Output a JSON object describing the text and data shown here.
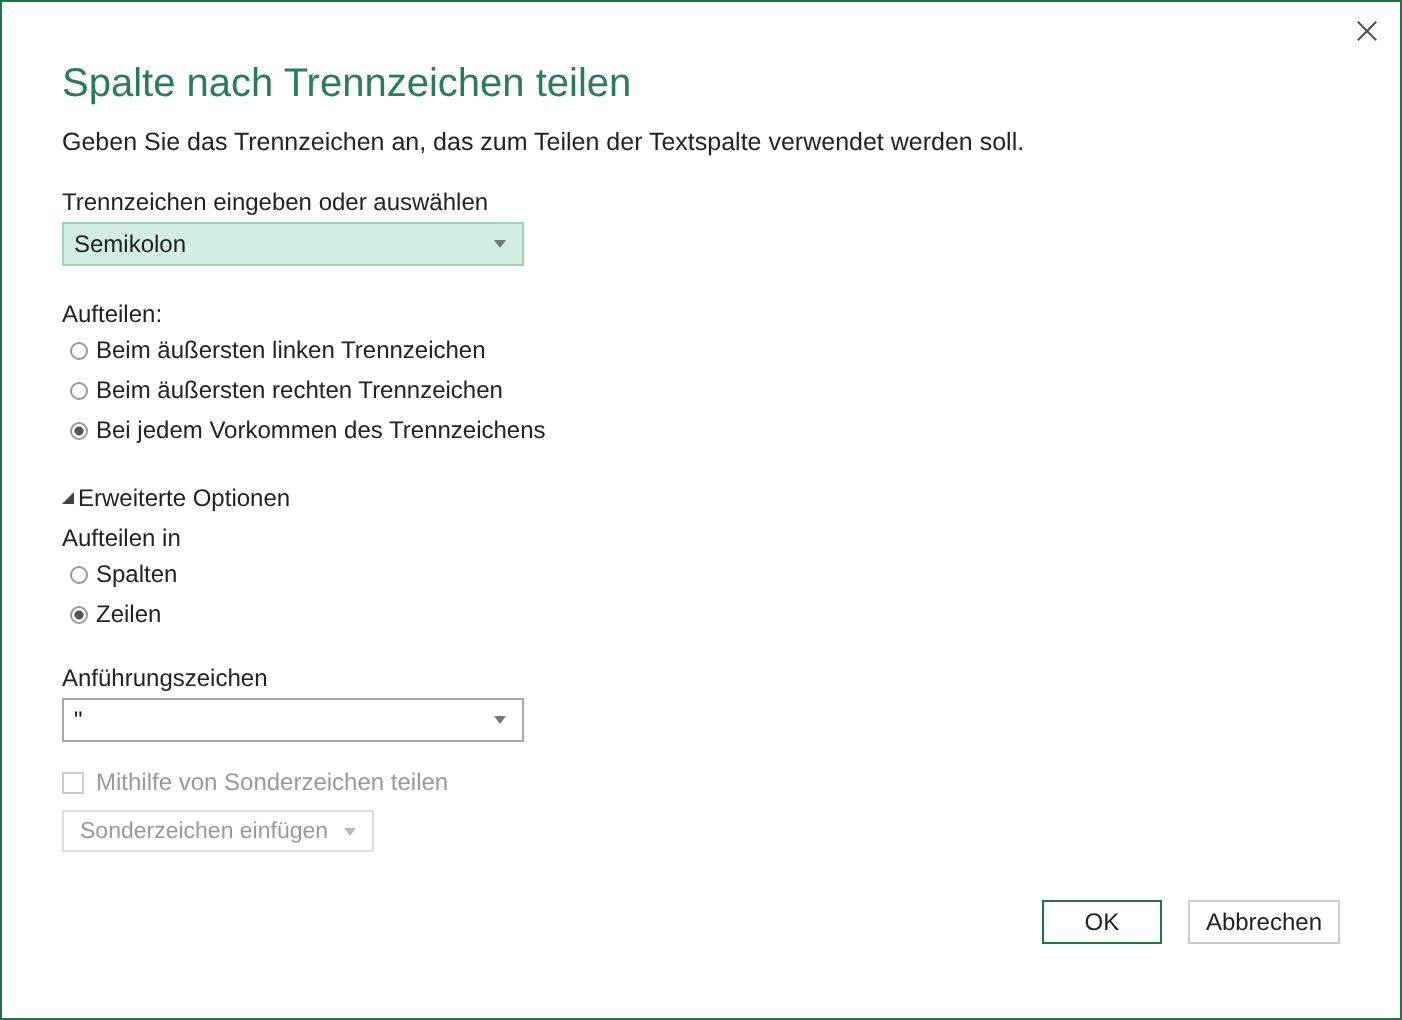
{
  "title": "Spalte nach Trennzeichen teilen",
  "instruction": "Geben Sie das Trennzeichen an, das zum Teilen der Textspalte verwendet werden soll.",
  "delimiter": {
    "label": "Trennzeichen eingeben oder auswählen",
    "value": "Semikolon",
    "highlighted": true
  },
  "split": {
    "label": "Aufteilen:",
    "options": [
      {
        "label": "Beim äußersten linken Trennzeichen",
        "selected": false
      },
      {
        "label": "Beim äußersten rechten Trennzeichen",
        "selected": false
      },
      {
        "label": "Bei jedem Vorkommen des Trennzeichens",
        "selected": true
      }
    ]
  },
  "advanced": {
    "label": "Erweiterte Optionen",
    "expanded": true
  },
  "split_into": {
    "label": "Aufteilen in",
    "options": [
      {
        "label": "Spalten",
        "selected": false
      },
      {
        "label": "Zeilen",
        "selected": true
      }
    ]
  },
  "quote": {
    "label": "Anführungszeichen",
    "value": "\"",
    "highlighted": false
  },
  "special_chars": {
    "label": "Mithilfe von Sonderzeichen teilen",
    "checked": false,
    "disabled": true
  },
  "insert_button": {
    "label": "Sonderzeichen einfügen",
    "disabled": true
  },
  "buttons": [
    {
      "label": "OK",
      "kind": "primary"
    },
    {
      "label": "Abbrechen",
      "kind": "default"
    }
  ]
}
